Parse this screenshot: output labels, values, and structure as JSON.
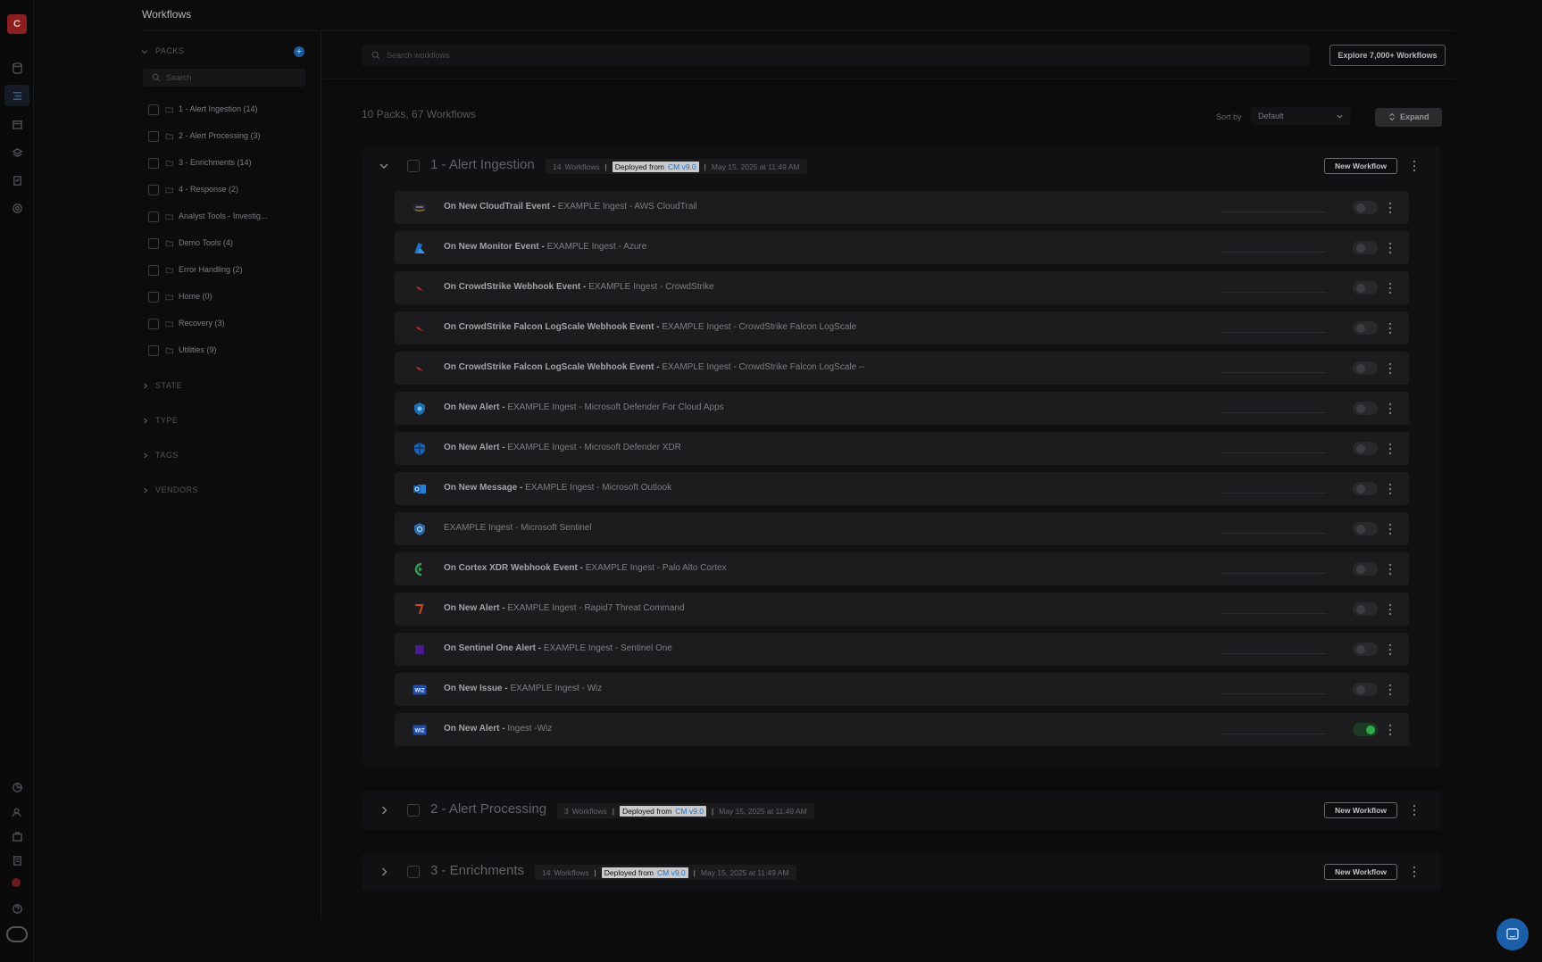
{
  "app": {
    "logo_letter": "C",
    "page_title": "Workflows"
  },
  "sidebar": {
    "packs_label": "PACKS",
    "add_symbol": "+",
    "search_placeholder": "Search",
    "packs": [
      "1 - Alert Ingestion (14)",
      "2 - Alert Processing (3)",
      "3 - Enrichments (14)",
      "4 - Response (2)",
      "Analyst Tools - Investig...",
      "Demo Tools (4)",
      "Error Handling (2)",
      "Home (0)",
      "Recovery (3)",
      "Utilities (9)"
    ],
    "facets": [
      "STATE",
      "TYPE",
      "TAGS",
      "VENDORS"
    ]
  },
  "toolbar": {
    "search_placeholder": "Search workflows",
    "explore_label": "Explore 7,000+ Workflows",
    "summary": "10 Packs, 67 Workflows",
    "sort_label": "Sort by",
    "sort_value": "Default",
    "expand_label": "Expand"
  },
  "packs": [
    {
      "name": "1 - Alert Ingestion",
      "count": "14",
      "workflows_word": "Workflows",
      "deployed_label": "Deployed from",
      "version": "CM v9.0",
      "date": "May 15, 2025 at 11:49 AM",
      "new_label": "New Workflow",
      "workflows": [
        {
          "trigger": "On New CloudTrail Event -",
          "name": "EXAMPLE Ingest - AWS CloudTrail",
          "icon": "aws-icon",
          "enabled": false
        },
        {
          "trigger": "On New Monitor Event -",
          "name": "EXAMPLE Ingest - Azure",
          "icon": "azure-icon",
          "enabled": false
        },
        {
          "trigger": "On CrowdStrike Webhook Event -",
          "name": "EXAMPLE Ingest - CrowdStrike",
          "icon": "crowdstrike-icon",
          "enabled": false
        },
        {
          "trigger": "On CrowdStrike Falcon LogScale Webhook Event -",
          "name": "EXAMPLE Ingest - CrowdStrike Falcon LogScale",
          "icon": "crowdstrike-icon",
          "enabled": false
        },
        {
          "trigger": "On CrowdStrike Falcon LogScale Webhook Event -",
          "name": "EXAMPLE Ingest - CrowdStrike Falcon LogScale --",
          "icon": "crowdstrike-icon",
          "enabled": false
        },
        {
          "trigger": "On New Alert -",
          "name": "EXAMPLE Ingest - Microsoft Defender For Cloud Apps",
          "icon": "defender-cloud-apps-icon",
          "enabled": false
        },
        {
          "trigger": "On New Alert -",
          "name": "EXAMPLE Ingest - Microsoft Defender XDR",
          "icon": "defender-xdr-icon",
          "enabled": false
        },
        {
          "trigger": "On New Message -",
          "name": "EXAMPLE Ingest - Microsoft Outlook",
          "icon": "outlook-icon",
          "enabled": false
        },
        {
          "trigger": "",
          "name": "EXAMPLE Ingest - Microsoft Sentinel",
          "icon": "sentinel-icon",
          "enabled": false
        },
        {
          "trigger": "On Cortex XDR Webhook Event -",
          "name": "EXAMPLE Ingest - Palo Alto Cortex",
          "icon": "cortex-icon",
          "enabled": false
        },
        {
          "trigger": "On New Alert -",
          "name": "EXAMPLE Ingest - Rapid7 Threat Command",
          "icon": "rapid7-icon",
          "enabled": false
        },
        {
          "trigger": "On Sentinel One Alert -",
          "name": "EXAMPLE Ingest - Sentinel One",
          "icon": "sentinelone-icon",
          "enabled": false
        },
        {
          "trigger": "On New Issue -",
          "name": "EXAMPLE Ingest - Wiz",
          "icon": "wiz-icon",
          "enabled": false
        },
        {
          "trigger": "On New Alert -",
          "name": "Ingest -Wiz",
          "icon": "wiz-icon",
          "enabled": true
        }
      ]
    },
    {
      "name": "2 - Alert Processing",
      "count": "3",
      "workflows_word": "Workflows",
      "deployed_label": "Deployed from",
      "version": "CM v9.0",
      "date": "May 15, 2025 at 11:49 AM",
      "new_label": "New Workflow"
    },
    {
      "name": "3 - Enrichments",
      "count": "14",
      "workflows_word": "Workflows",
      "deployed_label": "Deployed from",
      "version": "CM v9.0",
      "date": "May 15, 2025 at 11:49 AM",
      "new_label": "New Workflow"
    }
  ],
  "colors": {
    "accent": "#1c5a9c",
    "enabled_toggle": "#2faa4b",
    "logo": "#8b1e1e",
    "version_link": "#1a73c9"
  },
  "wiz_text": "WIZ"
}
